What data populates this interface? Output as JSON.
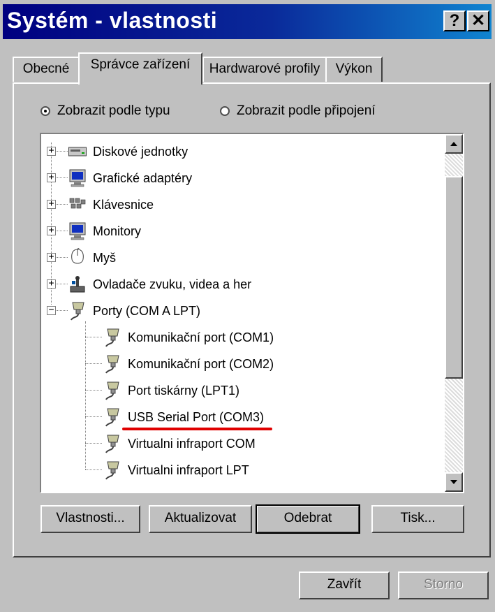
{
  "window": {
    "title": "Systém - vlastnosti",
    "help_label": "?",
    "close_label": "✕"
  },
  "tabs": [
    {
      "label": "Obecné",
      "active": false
    },
    {
      "label": "Správce zařízení",
      "active": true
    },
    {
      "label": "Hardwarové profily",
      "active": false
    },
    {
      "label": "Výkon",
      "active": false
    }
  ],
  "view_options": {
    "by_type": {
      "label": "Zobrazit podle typu",
      "checked": true
    },
    "by_connection": {
      "label": "Zobrazit podle připojení",
      "checked": false
    }
  },
  "tree": {
    "items": [
      {
        "label": "Diskové jednotky",
        "icon": "disk-drive-icon",
        "expander": "+"
      },
      {
        "label": "Grafické adaptéry",
        "icon": "monitor-icon",
        "expander": "+"
      },
      {
        "label": "Klávesnice",
        "icon": "keyboard-icon",
        "expander": "+"
      },
      {
        "label": "Monitory",
        "icon": "monitor-icon",
        "expander": "+"
      },
      {
        "label": "Myš",
        "icon": "mouse-icon",
        "expander": "+"
      },
      {
        "label": "Ovladače zvuku, videa a her",
        "icon": "joystick-icon",
        "expander": "+"
      },
      {
        "label": "Porty (COM A LPT)",
        "icon": "port-connector-icon",
        "expander": "−"
      }
    ],
    "children": [
      {
        "label": "Komunikační port (COM1)",
        "icon": "port-connector-icon"
      },
      {
        "label": "Komunikační port (COM2)",
        "icon": "port-connector-icon"
      },
      {
        "label": "Port tiskárny (LPT1)",
        "icon": "port-connector-icon"
      },
      {
        "label": "USB Serial Port (COM3)",
        "icon": "port-connector-icon",
        "highlighted": true
      },
      {
        "label": "Virtualni infraport COM",
        "icon": "port-connector-icon"
      },
      {
        "label": "Virtualni infraport LPT",
        "icon": "port-connector-icon"
      }
    ],
    "highlight_color": "#e00000"
  },
  "buttons": {
    "properties": "Vlastnosti...",
    "refresh": "Aktualizovat",
    "remove": "Odebrat",
    "print": "Tisk...",
    "close": "Zavřít",
    "cancel": "Storno"
  },
  "colors": {
    "titlebar_start": "#000080",
    "titlebar_end": "#1084d0",
    "face": "#c0c0c0"
  }
}
